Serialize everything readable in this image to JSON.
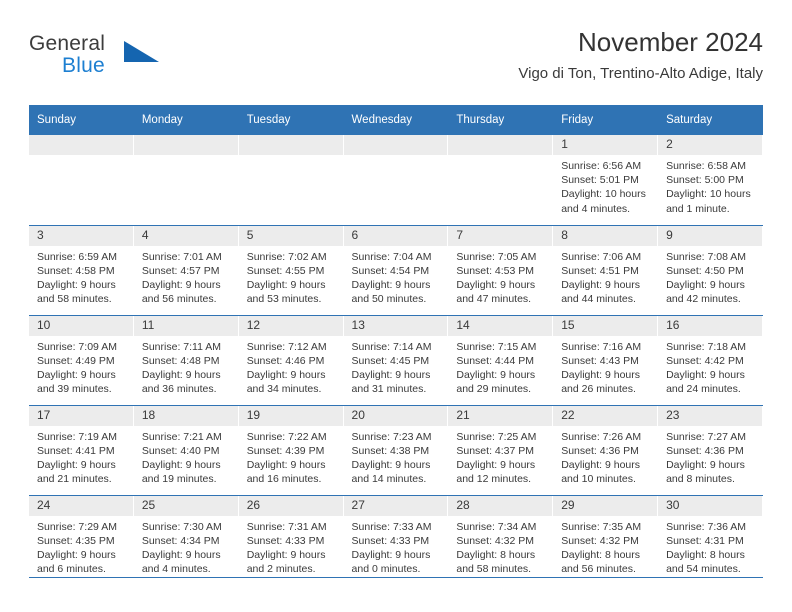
{
  "brand": {
    "line1": "General",
    "line2": "Blue",
    "triangle_color": "#1565b0"
  },
  "header": {
    "title": "November 2024",
    "subtitle": "Vigo di Ton, Trentino-Alto Adige, Italy",
    "header_bg": "#2f73b4",
    "daynum_bg": "#ececec"
  },
  "weekdays": [
    "Sunday",
    "Monday",
    "Tuesday",
    "Wednesday",
    "Thursday",
    "Friday",
    "Saturday"
  ],
  "weeks": [
    [
      {
        "day": "",
        "lines": []
      },
      {
        "day": "",
        "lines": []
      },
      {
        "day": "",
        "lines": []
      },
      {
        "day": "",
        "lines": []
      },
      {
        "day": "",
        "lines": []
      },
      {
        "day": "1",
        "lines": [
          "Sunrise: 6:56 AM",
          "Sunset: 5:01 PM",
          "Daylight: 10 hours",
          "and 4 minutes."
        ]
      },
      {
        "day": "2",
        "lines": [
          "Sunrise: 6:58 AM",
          "Sunset: 5:00 PM",
          "Daylight: 10 hours",
          "and 1 minute."
        ]
      }
    ],
    [
      {
        "day": "3",
        "lines": [
          "Sunrise: 6:59 AM",
          "Sunset: 4:58 PM",
          "Daylight: 9 hours",
          "and 58 minutes."
        ]
      },
      {
        "day": "4",
        "lines": [
          "Sunrise: 7:01 AM",
          "Sunset: 4:57 PM",
          "Daylight: 9 hours",
          "and 56 minutes."
        ]
      },
      {
        "day": "5",
        "lines": [
          "Sunrise: 7:02 AM",
          "Sunset: 4:55 PM",
          "Daylight: 9 hours",
          "and 53 minutes."
        ]
      },
      {
        "day": "6",
        "lines": [
          "Sunrise: 7:04 AM",
          "Sunset: 4:54 PM",
          "Daylight: 9 hours",
          "and 50 minutes."
        ]
      },
      {
        "day": "7",
        "lines": [
          "Sunrise: 7:05 AM",
          "Sunset: 4:53 PM",
          "Daylight: 9 hours",
          "and 47 minutes."
        ]
      },
      {
        "day": "8",
        "lines": [
          "Sunrise: 7:06 AM",
          "Sunset: 4:51 PM",
          "Daylight: 9 hours",
          "and 44 minutes."
        ]
      },
      {
        "day": "9",
        "lines": [
          "Sunrise: 7:08 AM",
          "Sunset: 4:50 PM",
          "Daylight: 9 hours",
          "and 42 minutes."
        ]
      }
    ],
    [
      {
        "day": "10",
        "lines": [
          "Sunrise: 7:09 AM",
          "Sunset: 4:49 PM",
          "Daylight: 9 hours",
          "and 39 minutes."
        ]
      },
      {
        "day": "11",
        "lines": [
          "Sunrise: 7:11 AM",
          "Sunset: 4:48 PM",
          "Daylight: 9 hours",
          "and 36 minutes."
        ]
      },
      {
        "day": "12",
        "lines": [
          "Sunrise: 7:12 AM",
          "Sunset: 4:46 PM",
          "Daylight: 9 hours",
          "and 34 minutes."
        ]
      },
      {
        "day": "13",
        "lines": [
          "Sunrise: 7:14 AM",
          "Sunset: 4:45 PM",
          "Daylight: 9 hours",
          "and 31 minutes."
        ]
      },
      {
        "day": "14",
        "lines": [
          "Sunrise: 7:15 AM",
          "Sunset: 4:44 PM",
          "Daylight: 9 hours",
          "and 29 minutes."
        ]
      },
      {
        "day": "15",
        "lines": [
          "Sunrise: 7:16 AM",
          "Sunset: 4:43 PM",
          "Daylight: 9 hours",
          "and 26 minutes."
        ]
      },
      {
        "day": "16",
        "lines": [
          "Sunrise: 7:18 AM",
          "Sunset: 4:42 PM",
          "Daylight: 9 hours",
          "and 24 minutes."
        ]
      }
    ],
    [
      {
        "day": "17",
        "lines": [
          "Sunrise: 7:19 AM",
          "Sunset: 4:41 PM",
          "Daylight: 9 hours",
          "and 21 minutes."
        ]
      },
      {
        "day": "18",
        "lines": [
          "Sunrise: 7:21 AM",
          "Sunset: 4:40 PM",
          "Daylight: 9 hours",
          "and 19 minutes."
        ]
      },
      {
        "day": "19",
        "lines": [
          "Sunrise: 7:22 AM",
          "Sunset: 4:39 PM",
          "Daylight: 9 hours",
          "and 16 minutes."
        ]
      },
      {
        "day": "20",
        "lines": [
          "Sunrise: 7:23 AM",
          "Sunset: 4:38 PM",
          "Daylight: 9 hours",
          "and 14 minutes."
        ]
      },
      {
        "day": "21",
        "lines": [
          "Sunrise: 7:25 AM",
          "Sunset: 4:37 PM",
          "Daylight: 9 hours",
          "and 12 minutes."
        ]
      },
      {
        "day": "22",
        "lines": [
          "Sunrise: 7:26 AM",
          "Sunset: 4:36 PM",
          "Daylight: 9 hours",
          "and 10 minutes."
        ]
      },
      {
        "day": "23",
        "lines": [
          "Sunrise: 7:27 AM",
          "Sunset: 4:36 PM",
          "Daylight: 9 hours",
          "and 8 minutes."
        ]
      }
    ],
    [
      {
        "day": "24",
        "lines": [
          "Sunrise: 7:29 AM",
          "Sunset: 4:35 PM",
          "Daylight: 9 hours",
          "and 6 minutes."
        ]
      },
      {
        "day": "25",
        "lines": [
          "Sunrise: 7:30 AM",
          "Sunset: 4:34 PM",
          "Daylight: 9 hours",
          "and 4 minutes."
        ]
      },
      {
        "day": "26",
        "lines": [
          "Sunrise: 7:31 AM",
          "Sunset: 4:33 PM",
          "Daylight: 9 hours",
          "and 2 minutes."
        ]
      },
      {
        "day": "27",
        "lines": [
          "Sunrise: 7:33 AM",
          "Sunset: 4:33 PM",
          "Daylight: 9 hours",
          "and 0 minutes."
        ]
      },
      {
        "day": "28",
        "lines": [
          "Sunrise: 7:34 AM",
          "Sunset: 4:32 PM",
          "Daylight: 8 hours",
          "and 58 minutes."
        ]
      },
      {
        "day": "29",
        "lines": [
          "Sunrise: 7:35 AM",
          "Sunset: 4:32 PM",
          "Daylight: 8 hours",
          "and 56 minutes."
        ]
      },
      {
        "day": "30",
        "lines": [
          "Sunrise: 7:36 AM",
          "Sunset: 4:31 PM",
          "Daylight: 8 hours",
          "and 54 minutes."
        ]
      }
    ]
  ]
}
